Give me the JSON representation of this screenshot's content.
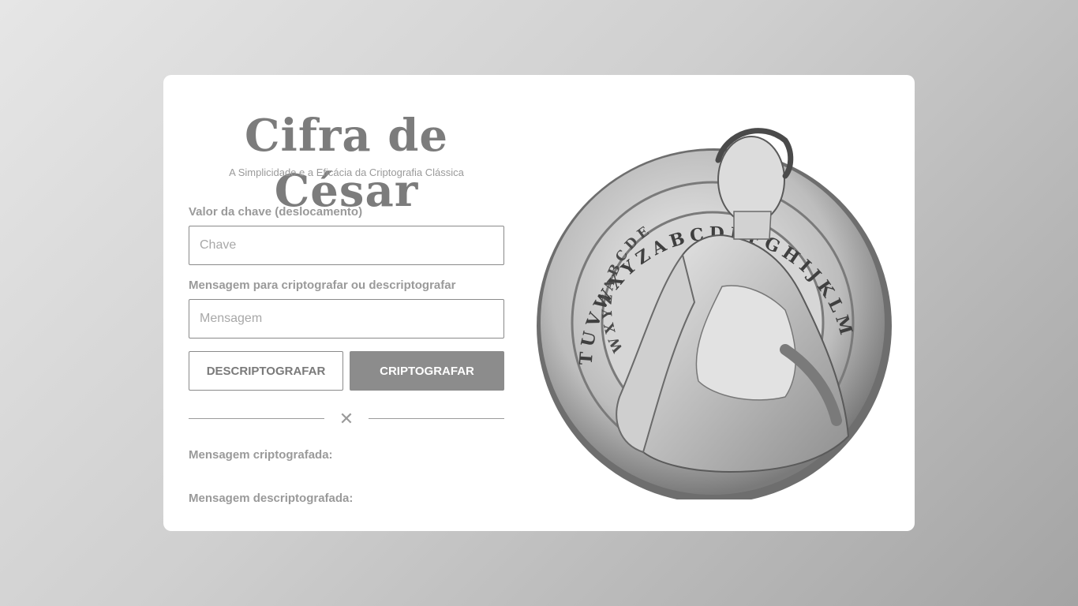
{
  "header": {
    "title": "Cifra de César",
    "subtitle": "A Simplicidade e a Eficácia da Criptografia Clássica"
  },
  "form": {
    "key_label": "Valor da chave (deslocamento)",
    "key_placeholder": "Chave",
    "key_value": "",
    "message_label": "Mensagem para criptografar ou descriptografar",
    "message_placeholder": "Mensagem",
    "message_value": ""
  },
  "actions": {
    "decrypt_label": "DESCRIPTOGRAFAR",
    "encrypt_label": "CRIPTOGRAFAR"
  },
  "results": {
    "encrypted_label": "Mensagem criptografada:",
    "encrypted_value": "",
    "decrypted_label": "Mensagem descriptografada:",
    "decrypted_value": ""
  },
  "illustration": {
    "outer_ring_letters": "TUVWXYZABCDEFGHIJKLM",
    "inner_ring_letters": "WXYZABCDE"
  },
  "colors": {
    "accent": "#8c8c8c",
    "text_muted": "#9a9a9a",
    "card_bg": "#ffffff"
  }
}
